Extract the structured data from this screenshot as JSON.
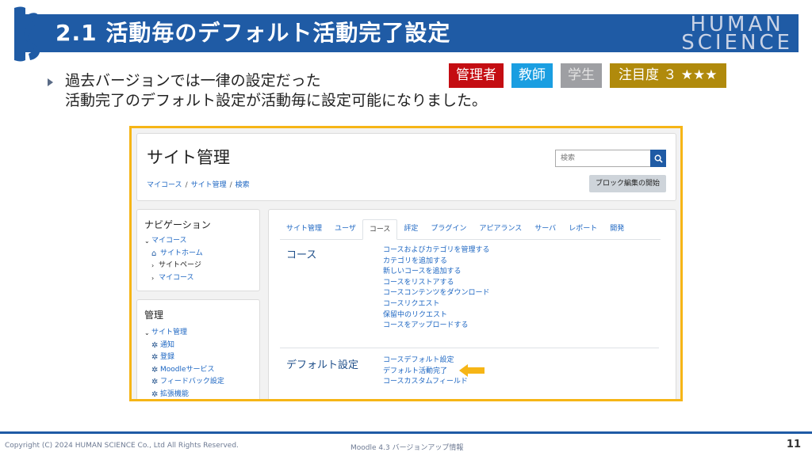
{
  "slide": {
    "title": "2.1 活動毎のデフォルト活動完了設定",
    "brand_line1": "HUMAN",
    "brand_line2": "SCIENCE",
    "bullet_line1": "過去バージョンでは一律の設定だった",
    "bullet_line2": "活動完了のデフォルト設定が活動毎に設定可能になりました。"
  },
  "badges": {
    "admin": "管理者",
    "teacher": "教師",
    "student": "学生",
    "attention": "注目度 ３ ★★★"
  },
  "site": {
    "title": "サイト管理",
    "breadcrumb": [
      "マイコース",
      "サイト管理",
      "検索"
    ],
    "search_placeholder": "検索",
    "block_edit_button": "ブロック編集の開始"
  },
  "navigation": {
    "title": "ナビゲーション",
    "root": "マイコース",
    "items": [
      "サイトホーム",
      "サイトページ",
      "マイコース"
    ]
  },
  "administration": {
    "title": "管理",
    "root": "サイト管理",
    "items": [
      "通知",
      "登録",
      "Moodleサービス",
      "フィードバック設定",
      "拡張機能"
    ]
  },
  "tabs": [
    "サイト管理",
    "ユーザ",
    "コース",
    "評定",
    "プラグイン",
    "アピアランス",
    "サーバ",
    "レポート",
    "開発"
  ],
  "active_tab": "コース",
  "sections": {
    "course": {
      "label": "コース",
      "links": [
        "コースおよびカテゴリを管理する",
        "カテゴリを追加する",
        "新しいコースを追加する",
        "コースをリストアする",
        "コースコンテンツをダウンロード",
        "コースリクエスト",
        "保留中のリクエスト",
        "コースをアップロードする"
      ]
    },
    "defaults": {
      "label": "デフォルト設定",
      "links": [
        "コースデフォルト設定",
        "デフォルト活動完了",
        "コースカスタムフィールド"
      ]
    }
  },
  "footer": {
    "copyright": "Copyright (C) 2024 HUMAN SCIENCE Co., Ltd All Rights Reserved.",
    "doc_title": "Moodle 4.3 バージョンアップ情報",
    "page_number": "11"
  },
  "colors": {
    "header_blue": "#1f5ba5",
    "frame_yellow": "#f6b516",
    "admin_red": "#c40d12",
    "teacher_blue": "#1a9ee1",
    "student_gray": "#9e9fa3",
    "attention_gold": "#b08a0c",
    "arrow": "#f6b516"
  },
  "icons": [
    "logo-mark",
    "search-icon",
    "house-icon",
    "gear-icon",
    "chevron-icon",
    "arrow-icon"
  ]
}
